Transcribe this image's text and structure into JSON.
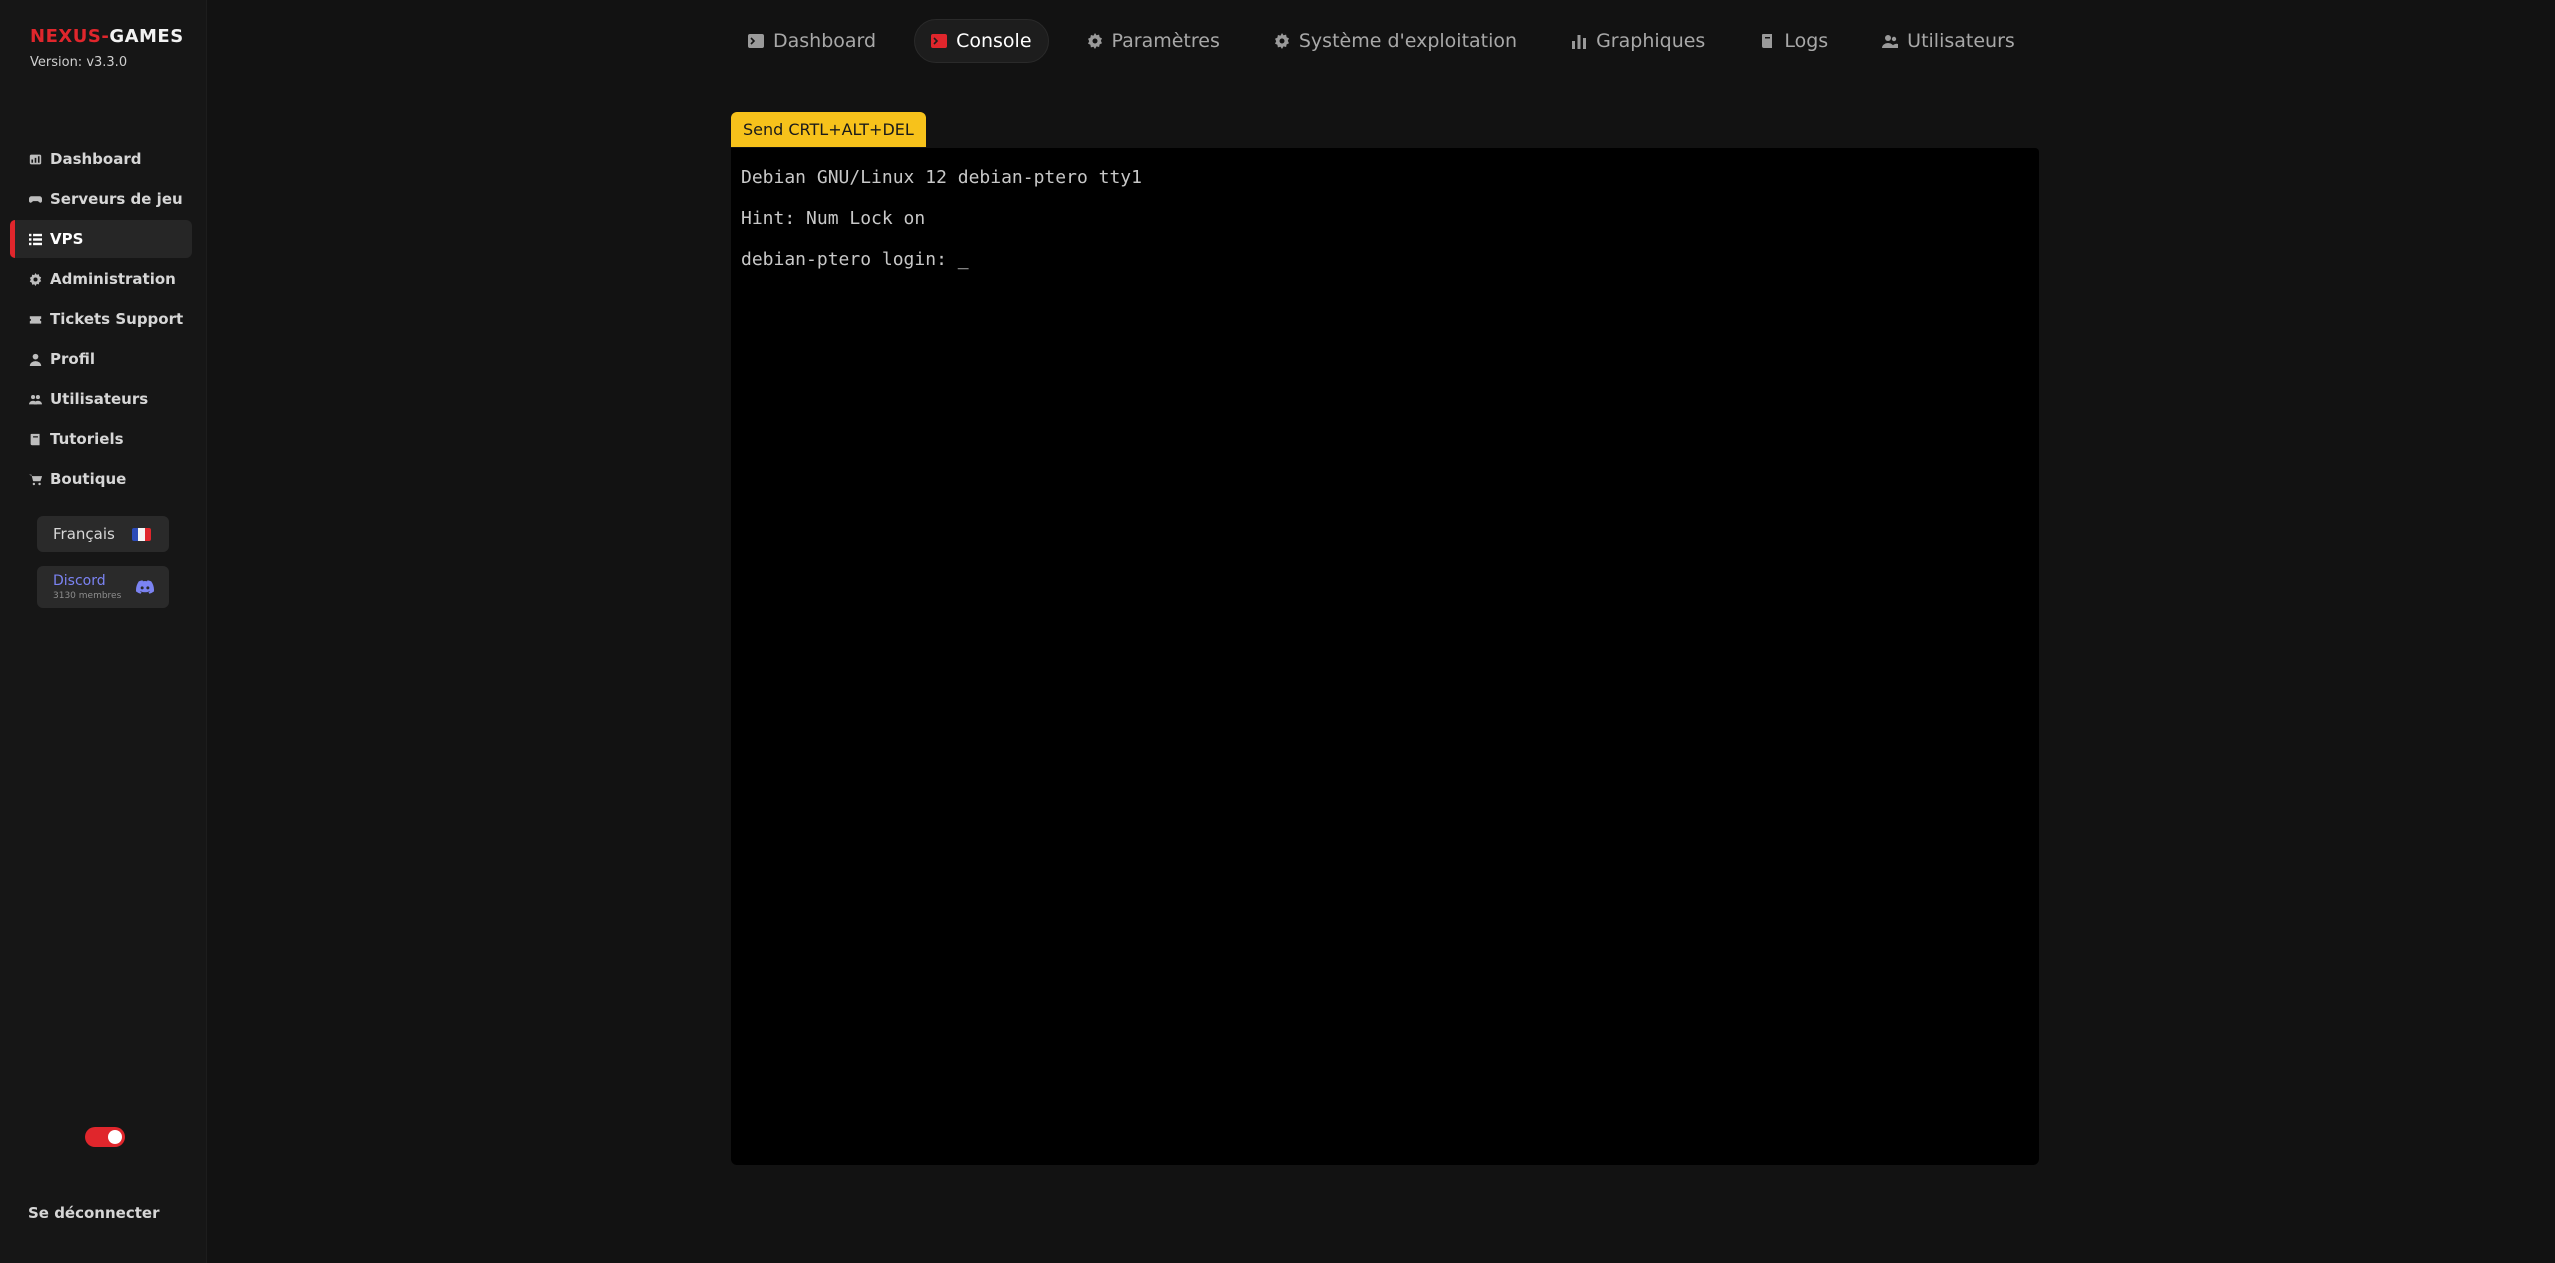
{
  "brand": {
    "name_part1": "NEXUS",
    "name_separator": "-",
    "name_part2": "GAMES",
    "version": "Version: v3.3.0"
  },
  "sidebar": {
    "items": [
      {
        "label": "Dashboard",
        "icon": "dashboard-icon"
      },
      {
        "label": "Serveurs de jeu",
        "icon": "gamepad-icon"
      },
      {
        "label": "VPS",
        "icon": "server-list-icon",
        "active": true
      },
      {
        "label": "Administration",
        "icon": "gear-icon"
      },
      {
        "label": "Tickets Support",
        "icon": "ticket-icon"
      },
      {
        "label": "Profil",
        "icon": "user-icon"
      },
      {
        "label": "Utilisateurs",
        "icon": "users-icon"
      },
      {
        "label": "Tutoriels",
        "icon": "book-icon"
      },
      {
        "label": "Boutique",
        "icon": "cart-icon"
      }
    ],
    "language": {
      "label": "Français",
      "flag": "france-flag-icon"
    },
    "discord": {
      "label": "Discord",
      "members": "3130 membres",
      "icon": "discord-icon"
    },
    "logout_label": "Se déconnecter"
  },
  "tabs": [
    {
      "label": "Dashboard",
      "icon": "terminal-icon"
    },
    {
      "label": "Console",
      "icon": "console-icon",
      "active": true
    },
    {
      "label": "Paramètres",
      "icon": "gear-icon"
    },
    {
      "label": "Système d'exploitation",
      "icon": "gear-icon"
    },
    {
      "label": "Graphiques",
      "icon": "bar-chart-icon"
    },
    {
      "label": "Logs",
      "icon": "book-icon"
    },
    {
      "label": "Utilisateurs",
      "icon": "users-icon"
    }
  ],
  "console": {
    "cad_button_label": "Send CRTL+ALT+DEL",
    "lines": [
      "Debian GNU/Linux 12 debian-ptero tty1",
      "Hint: Num Lock on",
      "debian-ptero login: "
    ],
    "cursor": "_"
  },
  "colors": {
    "accent": "#e0262c",
    "warning_button": "#f7c21b",
    "discord": "#7b83f2",
    "background": "#121212",
    "sidebar": "#161616",
    "terminal": "#000000"
  }
}
